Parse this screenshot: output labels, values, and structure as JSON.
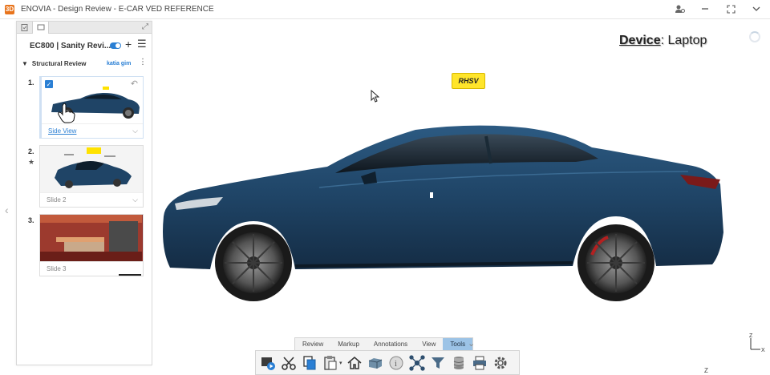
{
  "window": {
    "title": "ENOVIA - Design Review - E-CAR VED REFERENCE",
    "logo_text": "3D"
  },
  "panel": {
    "header_title": "EC800 | Sanity Revi...",
    "review": {
      "name": "Structural Review",
      "user": "katia gim"
    },
    "slides": [
      {
        "number": "1.",
        "label": "Side View",
        "checked": true
      },
      {
        "number": "2.",
        "label": "Slide 2",
        "starred": true
      },
      {
        "number": "3.",
        "label": "Slide 3"
      }
    ]
  },
  "viewport": {
    "device_label_key": "Device",
    "device_label_value": ": Laptop",
    "annotation_tag": "RHSV",
    "car_color": "#1f4466",
    "axis_labels": {
      "z": "Z",
      "x": "X"
    }
  },
  "toolbar": {
    "tabs": [
      "Review",
      "Markup",
      "Annotations",
      "View",
      "Tools"
    ],
    "active_tab": "Tools",
    "tools": [
      "render-icon",
      "cut-icon",
      "copy-icon",
      "paste-icon",
      "home-icon",
      "cube-icon",
      "info-icon",
      "network-icon",
      "filter-icon",
      "database-icon",
      "print-icon",
      "gear-icon"
    ]
  },
  "bottom_mark": "Z"
}
